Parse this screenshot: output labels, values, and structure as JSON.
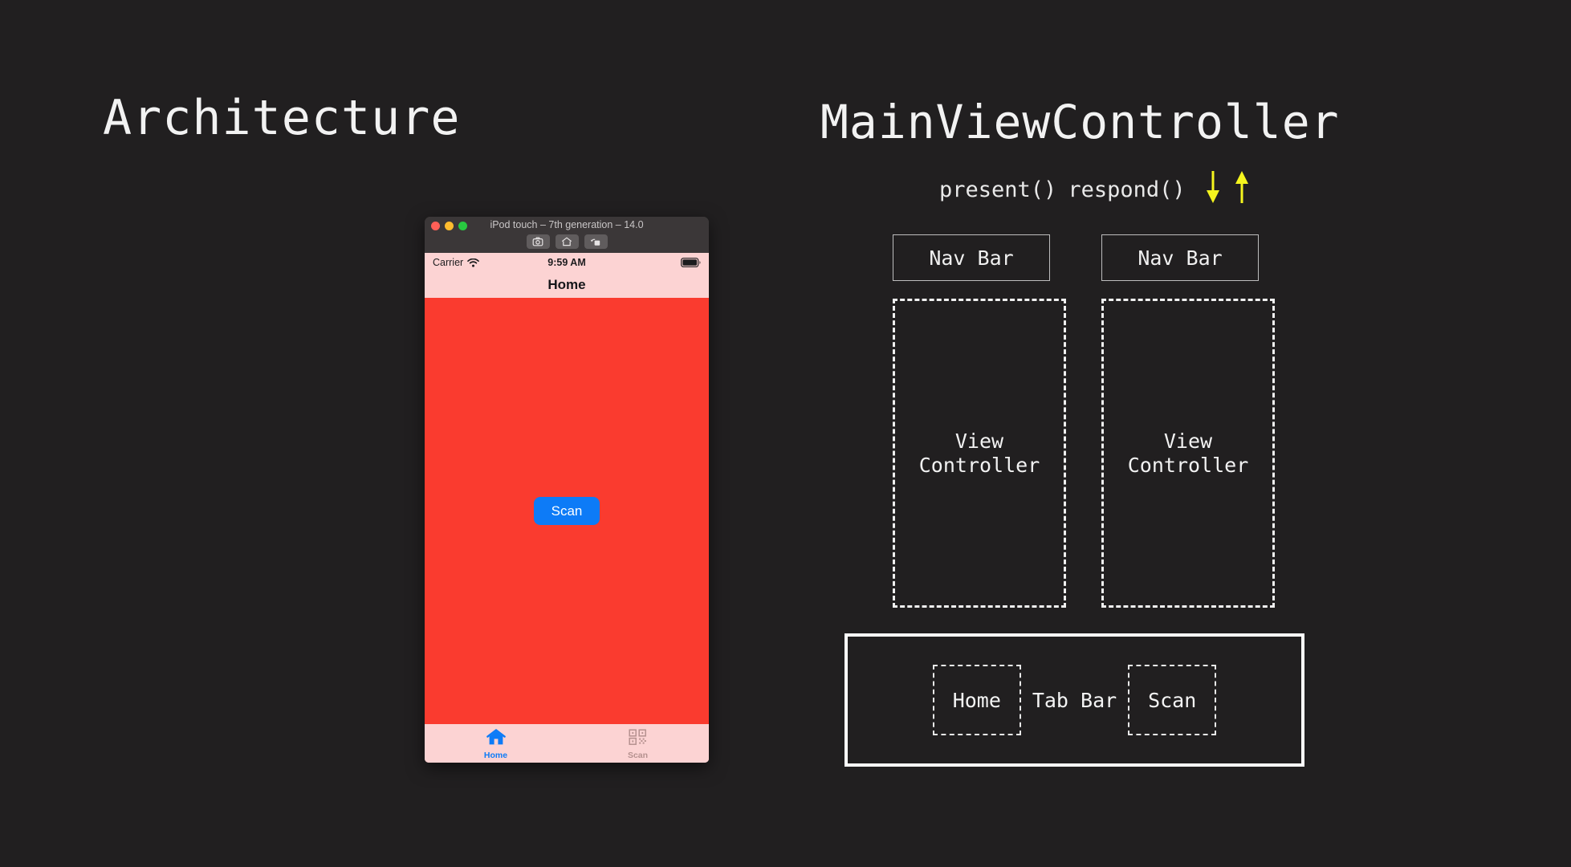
{
  "headings": {
    "left_title": "Architecture",
    "right_title": "MainViewController"
  },
  "flow": {
    "present_label": "present()",
    "respond_label": "respond()",
    "down_arrow_icon": "arrow-down-icon",
    "up_arrow_icon": "arrow-up-icon",
    "arrow_color": "#f5f51e"
  },
  "simulator": {
    "window_title": "iPod touch – 7th generation – 14.0",
    "traffic_lights": [
      {
        "name": "close",
        "color": "#ff5f57"
      },
      {
        "name": "minimize",
        "color": "#febc2e"
      },
      {
        "name": "zoom",
        "color": "#28c840"
      }
    ],
    "toolbar_buttons": [
      {
        "name": "screenshot-button",
        "icon": "camera-icon"
      },
      {
        "name": "home-button",
        "icon": "home-icon"
      },
      {
        "name": "rotate-button",
        "icon": "rotate-icon"
      }
    ],
    "status_bar": {
      "carrier": "Carrier",
      "wifi_icon": "wifi-icon",
      "time": "9:59 AM",
      "battery_icon": "battery-full-icon"
    },
    "nav_bar": {
      "title": "Home"
    },
    "content": {
      "background_color": "#fa3b2f",
      "scan_button_label": "Scan",
      "scan_button_color": "#0d7bf7"
    },
    "tab_bar": {
      "tabs": [
        {
          "label": "Home",
          "icon": "home-icon",
          "selected": true
        },
        {
          "label": "Scan",
          "icon": "qrcode-icon",
          "selected": false
        }
      ]
    },
    "chrome_color": "#3b3738",
    "screen_chrome_color": "#fcd3d3"
  },
  "diagram": {
    "nav_bar_left": "Nav Bar",
    "nav_bar_right": "Nav Bar",
    "view_controller_left_line1": "View",
    "view_controller_left_line2": "Controller",
    "view_controller_right_line1": "View",
    "view_controller_right_line2": "Controller",
    "tab_bar_label": "Tab Bar",
    "tab_home_label": "Home",
    "tab_scan_label": "Scan"
  },
  "colors": {
    "page_background": "#211f20",
    "text": "#f2f2f2",
    "accent_blue": "#0d7bf7",
    "accent_red": "#fa3b2f",
    "accent_pink": "#fcd3d3",
    "accent_yellow": "#f5f51e"
  }
}
